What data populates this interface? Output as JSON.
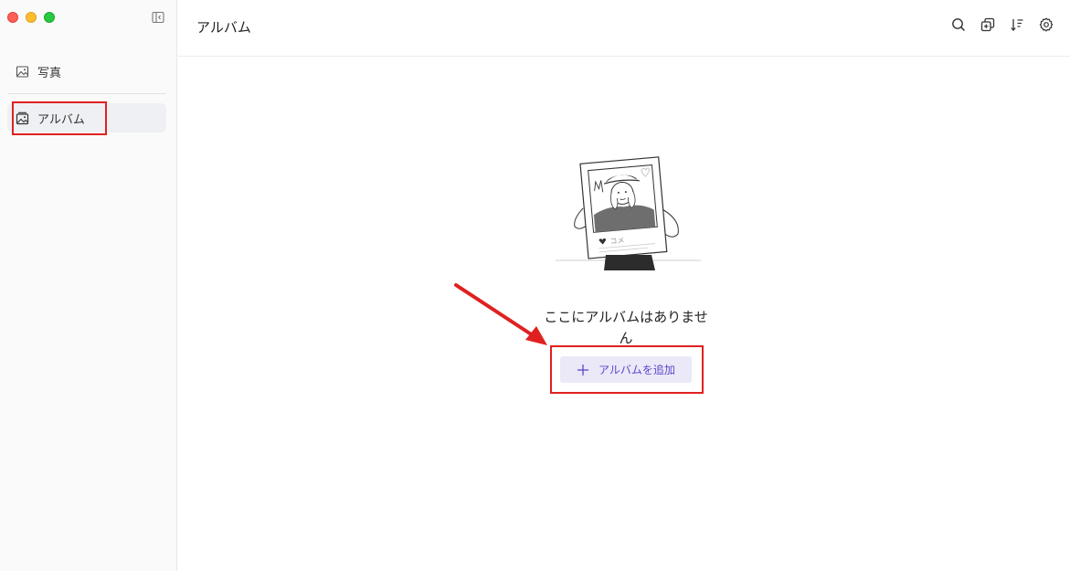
{
  "window": {
    "controls": [
      "close",
      "minimize",
      "zoom"
    ]
  },
  "sidebar": {
    "items": [
      {
        "label": "写真",
        "icon": "image-icon"
      },
      {
        "label": "アルバム",
        "icon": "album-icon",
        "selected": true
      }
    ]
  },
  "header": {
    "title": "アルバム",
    "tools": [
      "search-icon",
      "multi-select-icon",
      "sort-icon",
      "settings-icon"
    ]
  },
  "empty_state": {
    "message": "ここにアルバムはありません",
    "add_button_label": "アルバムを追加",
    "illustration_text": "コメ"
  },
  "colors": {
    "accent": "#5b47c9",
    "accent_bg": "#ebe8f8",
    "highlight_red": "#e02020"
  }
}
